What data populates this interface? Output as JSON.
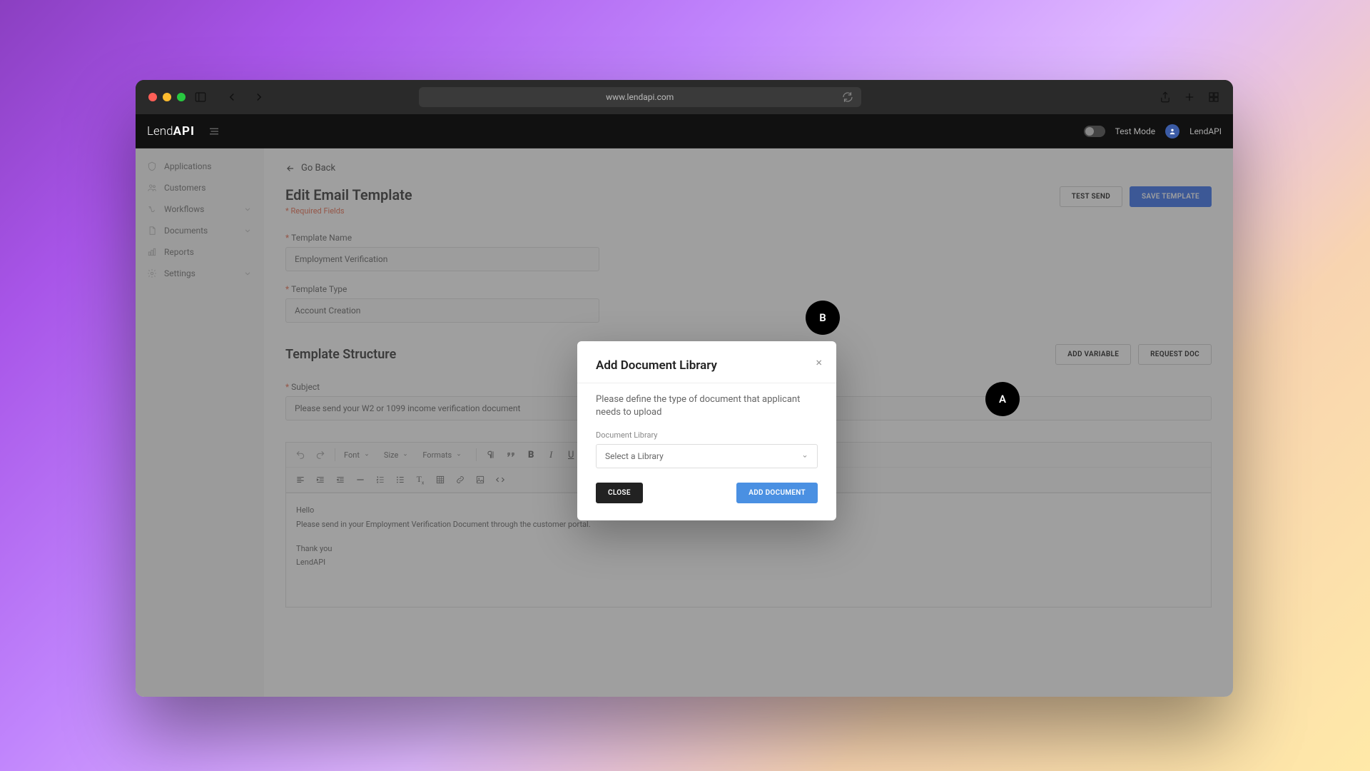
{
  "browser": {
    "url": "www.lendapi.com"
  },
  "header": {
    "brand_prefix": "Lend",
    "brand_bold": "API",
    "test_mode_label": "Test Mode",
    "user_label": "LendAPI"
  },
  "sidebar": {
    "items": [
      {
        "label": "Applications",
        "icon": "shield-icon",
        "expandable": false
      },
      {
        "label": "Customers",
        "icon": "users-icon",
        "expandable": false
      },
      {
        "label": "Workflows",
        "icon": "workflow-icon",
        "expandable": true
      },
      {
        "label": "Documents",
        "icon": "document-icon",
        "expandable": true
      },
      {
        "label": "Reports",
        "icon": "chart-icon",
        "expandable": false
      },
      {
        "label": "Settings",
        "icon": "gear-icon",
        "expandable": true
      }
    ]
  },
  "main": {
    "go_back": "Go Back",
    "page_title": "Edit Email Template",
    "required_note": "* Required Fields",
    "test_send": "TEST SEND",
    "save_template": "SAVE TEMPLATE",
    "template_name_label": "Template Name",
    "template_name_value": "Employment Verification",
    "template_type_label": "Template Type",
    "template_type_value": "Account Creation",
    "structure_title": "Template Structure",
    "add_variable": "ADD VARIABLE",
    "request_doc": "REQUEST DOC",
    "subject_label": "Subject",
    "subject_value": "Please send your W2 or 1099 income verification document",
    "toolbar": {
      "font": "Font",
      "size": "Size",
      "formats": "Formats"
    },
    "body_line1": "Hello",
    "body_line2": "Please send in your Employment Verification Document through the customer portal.",
    "body_line3": "Thank you",
    "body_line4": "LendAPI"
  },
  "modal": {
    "title": "Add Document Library",
    "description": "Please define the type of document that applicant needs to upload",
    "library_label": "Document Library",
    "library_placeholder": "Select a Library",
    "close": "CLOSE",
    "add": "ADD DOCUMENT"
  },
  "annotations": {
    "a": "A",
    "b": "B"
  }
}
